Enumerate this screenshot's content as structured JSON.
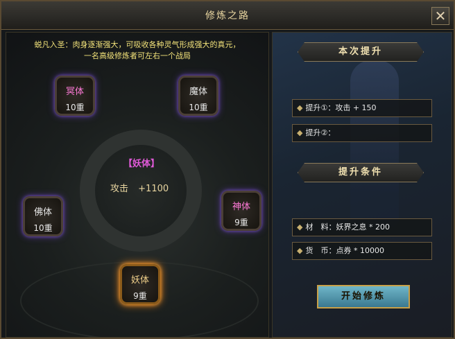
{
  "window": {
    "title": "修炼之路",
    "close_label": "✕"
  },
  "intro": {
    "line1": "蜕凡入圣：肉身逐渐强大，可吸收各种灵气形成强大的真元，",
    "line2": "一名高级修炼者可左右一个战局"
  },
  "center": {
    "name": "【妖体】",
    "stat_label": "攻击",
    "stat_value": "+1100"
  },
  "bodies": [
    {
      "name": "冥体",
      "level": "10重"
    },
    {
      "name": "魔体",
      "level": "10重"
    },
    {
      "name": "佛体",
      "level": "10重"
    },
    {
      "name": "神体",
      "level": "9重"
    },
    {
      "name": "妖体",
      "level": "9重"
    }
  ],
  "upgrade": {
    "header": "本次提升",
    "line1": "提升①：攻击 + 150",
    "line2": "提升②："
  },
  "condition": {
    "header": "提升条件",
    "material": "材　料：妖界之息 * 200",
    "currency": "货　币：点券 * 10000"
  },
  "action": {
    "button_label": "开始修炼"
  },
  "colors": {
    "title": "#e8d5a0",
    "intro": "#f2e27a",
    "selected_glow": "#ff8a1a",
    "node_glow": "#5a3a9a",
    "center_name": "#e05ad8"
  }
}
